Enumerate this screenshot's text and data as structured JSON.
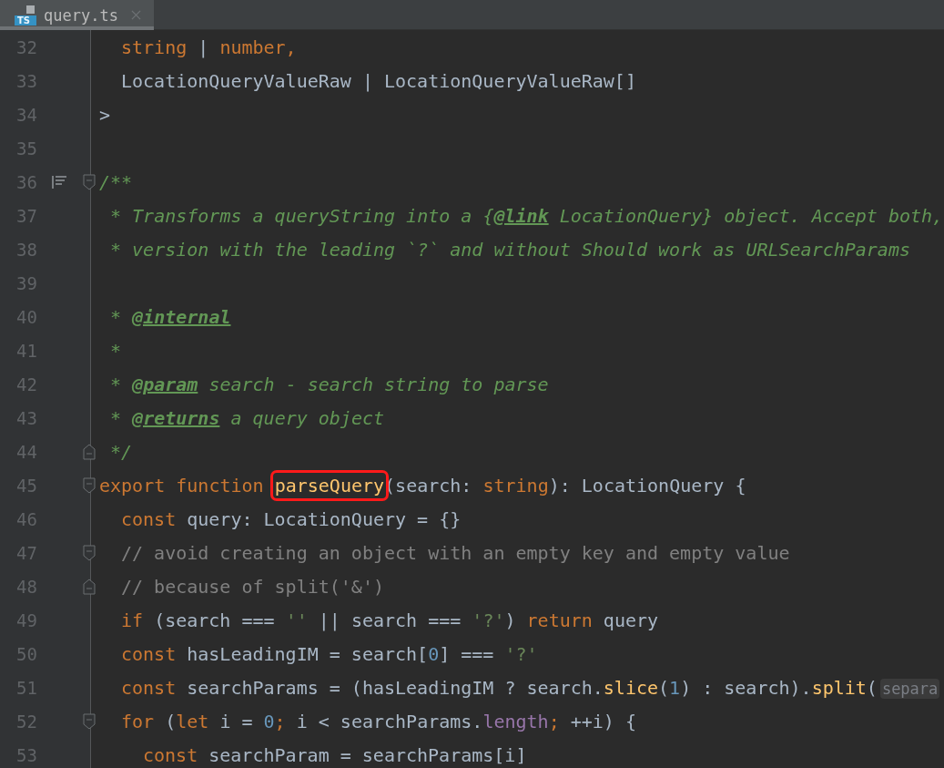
{
  "tab": {
    "label": "query.ts",
    "icon_text": "TS",
    "selected": true
  },
  "lines": [
    {
      "number": "32",
      "kind": "member",
      "tokens": [
        {
          "t": "string",
          "kind": "kw"
        },
        {
          "t": " | ",
          "kind": "id"
        },
        {
          "t": "number,",
          "kind": "kw"
        }
      ]
    },
    {
      "number": "33",
      "kind": "member",
      "tokens": [
        {
          "t": "LocationQueryValueRaw | LocationQueryValueRaw[]",
          "kind": "id"
        }
      ]
    },
    {
      "number": "34",
      "kind": "top",
      "tokens": [
        {
          "t": ">",
          "kind": "id"
        }
      ]
    },
    {
      "number": "35"
    },
    {
      "number": "36",
      "kind": "top",
      "doc_toggle": true,
      "fold_start": true,
      "tokens": [
        {
          "t": "/**",
          "kind": "doc"
        }
      ]
    },
    {
      "number": "37",
      "kind": "doc",
      "tokens": [
        {
          "t": "* Transforms a queryString into a {",
          "kind": "doc"
        },
        {
          "t": "@link",
          "kind": "doctag"
        },
        {
          "t": " LocationQuery} object. Accept both,",
          "kind": "doc"
        }
      ]
    },
    {
      "number": "38",
      "kind": "doc",
      "tokens": [
        {
          "t": "* version with the leading `?` and without Should work as URLSearchParams",
          "kind": "doc"
        }
      ]
    },
    {
      "number": "39"
    },
    {
      "number": "40",
      "kind": "doc",
      "tokens": [
        {
          "t": "* ",
          "kind": "doc"
        },
        {
          "t": "@internal",
          "kind": "doctag"
        }
      ]
    },
    {
      "number": "41",
      "kind": "doc",
      "tokens": [
        {
          "t": "*",
          "kind": "doc"
        }
      ]
    },
    {
      "number": "42",
      "kind": "doc",
      "tokens": [
        {
          "t": "* ",
          "kind": "doc"
        },
        {
          "t": "@param",
          "kind": "doctag"
        },
        {
          "t": " search - search string to parse",
          "kind": "doc"
        }
      ]
    },
    {
      "number": "43",
      "kind": "doc",
      "tokens": [
        {
          "t": "* ",
          "kind": "doc"
        },
        {
          "t": "@returns",
          "kind": "doctag"
        },
        {
          "t": " a query object",
          "kind": "doc"
        }
      ]
    },
    {
      "number": "44",
      "kind": "doc",
      "fold_end": true,
      "tokens": [
        {
          "t": "*/",
          "kind": "doc"
        }
      ]
    },
    {
      "number": "45",
      "kind": "top",
      "fold_start": true,
      "tokens": [
        {
          "t": "export function ",
          "kind": "kw"
        },
        {
          "t": "parseQuery",
          "kind": "fn",
          "boxed": true
        },
        {
          "t": "(search: ",
          "kind": "id"
        },
        {
          "t": "string",
          "kind": "kw"
        },
        {
          "t": "): LocationQuery {",
          "kind": "id"
        }
      ]
    },
    {
      "number": "46",
      "kind": "member",
      "tokens": [
        {
          "t": "const ",
          "kind": "kw"
        },
        {
          "t": "query: LocationQuery = {}",
          "kind": "id"
        }
      ]
    },
    {
      "number": "47",
      "kind": "member",
      "fold_start": true,
      "tokens": [
        {
          "t": "// avoid creating an object with an empty key and empty value",
          "kind": "comment"
        }
      ]
    },
    {
      "number": "48",
      "kind": "member",
      "fold_end": true,
      "tokens": [
        {
          "t": "// because of split('&')",
          "kind": "comment"
        }
      ]
    },
    {
      "number": "49",
      "kind": "member",
      "tokens": [
        {
          "t": "if ",
          "kind": "kw"
        },
        {
          "t": "(search === ",
          "kind": "id"
        },
        {
          "t": "''",
          "kind": "str"
        },
        {
          "t": " || search === ",
          "kind": "id"
        },
        {
          "t": "'?'",
          "kind": "str"
        },
        {
          "t": ") ",
          "kind": "id"
        },
        {
          "t": "return ",
          "kind": "kw"
        },
        {
          "t": "query",
          "kind": "id"
        }
      ]
    },
    {
      "number": "50",
      "kind": "member",
      "tokens": [
        {
          "t": "const ",
          "kind": "kw"
        },
        {
          "t": "hasLeadingIM = search[",
          "kind": "id"
        },
        {
          "t": "0",
          "kind": "num"
        },
        {
          "t": "] === ",
          "kind": "id"
        },
        {
          "t": "'?'",
          "kind": "str"
        }
      ]
    },
    {
      "number": "51",
      "kind": "member",
      "tokens": [
        {
          "t": "const ",
          "kind": "kw"
        },
        {
          "t": "searchParams = (hasLeadingIM ? search.",
          "kind": "id"
        },
        {
          "t": "slice",
          "kind": "fn"
        },
        {
          "t": "(",
          "kind": "id"
        },
        {
          "t": "1",
          "kind": "num"
        },
        {
          "t": ") : search).",
          "kind": "id"
        },
        {
          "t": "split",
          "kind": "fn"
        },
        {
          "t": "(",
          "kind": "id"
        },
        {
          "t": "separa",
          "kind": "hint"
        }
      ]
    },
    {
      "number": "52",
      "kind": "member",
      "fold_start": true,
      "tokens": [
        {
          "t": "for ",
          "kind": "kw"
        },
        {
          "t": "(",
          "kind": "id"
        },
        {
          "t": "let ",
          "kind": "kw"
        },
        {
          "t": "i = ",
          "kind": "id"
        },
        {
          "t": "0",
          "kind": "num"
        },
        {
          "t": "; ",
          "kind": "kw"
        },
        {
          "t": "i < searchParams.",
          "kind": "id"
        },
        {
          "t": "length",
          "kind": "prop"
        },
        {
          "t": "; ",
          "kind": "kw"
        },
        {
          "t": "++i) {",
          "kind": "id"
        }
      ]
    },
    {
      "number": "53",
      "kind": "nested",
      "tokens": [
        {
          "t": "const ",
          "kind": "kw"
        },
        {
          "t": "searchParam = searchParams[i]",
          "kind": "id"
        }
      ]
    }
  ]
}
